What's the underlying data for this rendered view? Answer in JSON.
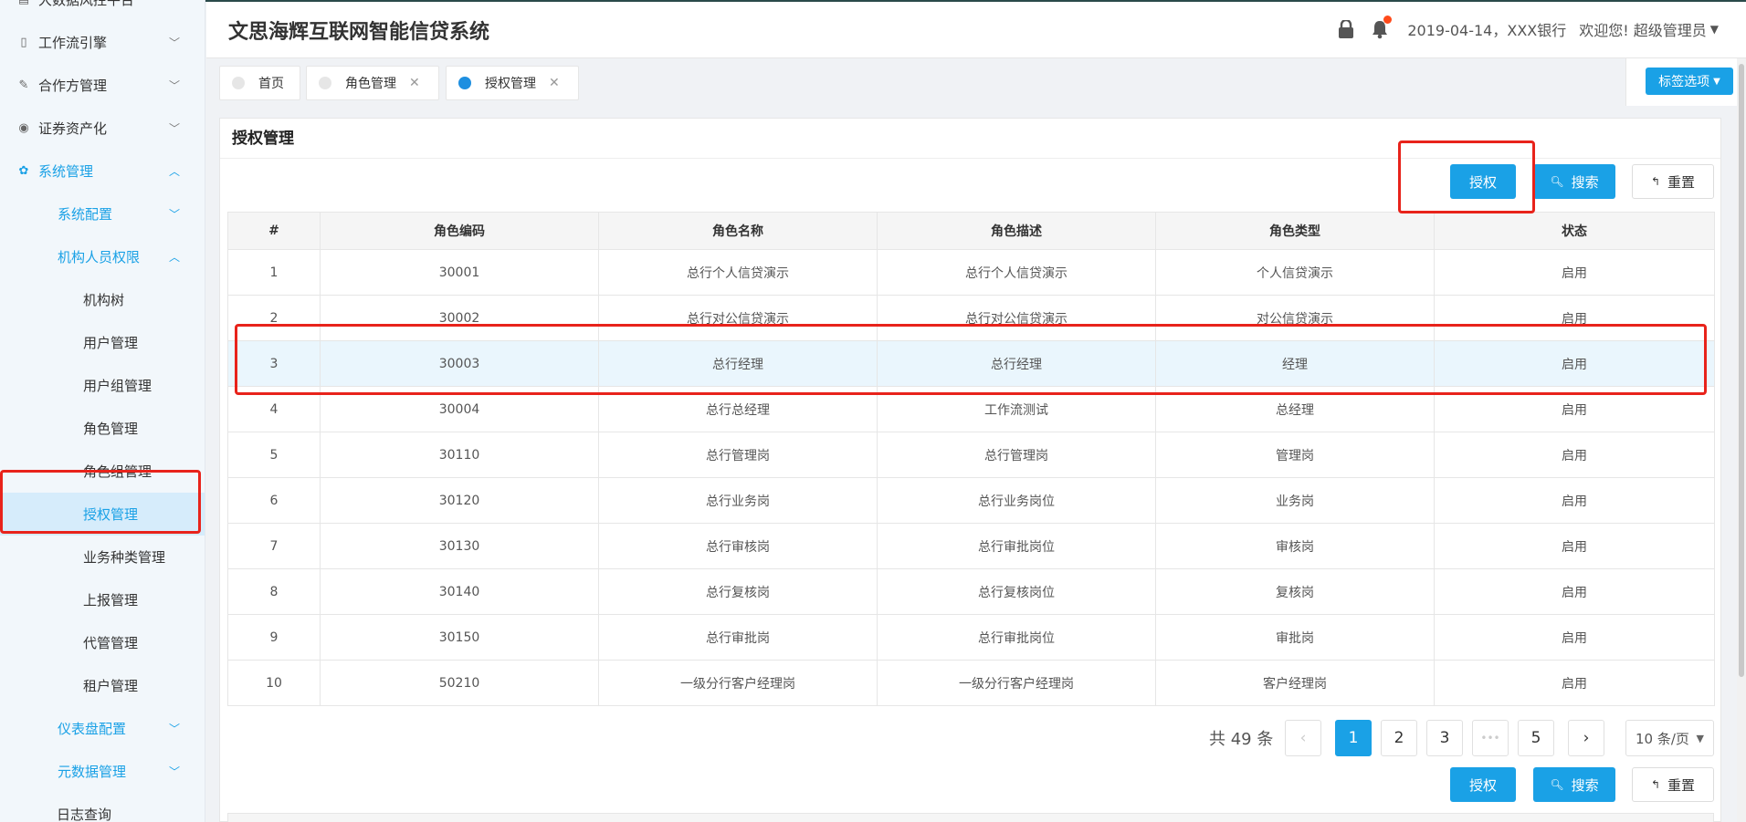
{
  "app": {
    "title": "文思海辉互联网智能信贷系统",
    "date_bank": "2019-04-14，XXX银行",
    "welcome": "欢迎您! 超级管理员",
    "accent": "#1aa1e6"
  },
  "sidebar": {
    "items": [
      {
        "label": "大数据风控平台",
        "icon": "chart-icon"
      },
      {
        "label": "工作流引擎",
        "icon": "mobile-icon"
      },
      {
        "label": "合作方管理",
        "icon": "brush-icon"
      },
      {
        "label": "证券资产化",
        "icon": "target-icon"
      },
      {
        "label": "系统管理",
        "icon": "gear-icon"
      },
      {
        "label": "系统配置"
      },
      {
        "label": "机构人员权限"
      },
      {
        "label": "机构树"
      },
      {
        "label": "用户管理"
      },
      {
        "label": "用户组管理"
      },
      {
        "label": "角色管理"
      },
      {
        "label": "角色组管理"
      },
      {
        "label": "授权管理"
      },
      {
        "label": "业务种类管理"
      },
      {
        "label": "上报管理"
      },
      {
        "label": "代管管理"
      },
      {
        "label": "租户管理"
      },
      {
        "label": "仪表盘配置"
      },
      {
        "label": "元数据管理"
      },
      {
        "label": "日志查询"
      }
    ]
  },
  "tabs": [
    {
      "label": "首页"
    },
    {
      "label": "角色管理"
    },
    {
      "label": "授权管理"
    }
  ],
  "tab_options": "标签选项",
  "panel": {
    "title": "授权管理",
    "auth_button": "授权",
    "search_button": "搜索",
    "reset_button": "重置"
  },
  "table": {
    "headers": [
      "#",
      "角色编码",
      "角色名称",
      "角色描述",
      "角色类型",
      "状态"
    ],
    "rows": [
      [
        "1",
        "30001",
        "总行个人信贷演示",
        "总行个人信贷演示",
        "个人信贷演示",
        "启用"
      ],
      [
        "2",
        "30002",
        "总行对公信贷演示",
        "总行对公信贷演示",
        "对公信贷演示",
        "启用"
      ],
      [
        "3",
        "30003",
        "总行经理",
        "总行经理",
        "经理",
        "启用"
      ],
      [
        "4",
        "30004",
        "总行总经理",
        "工作流测试",
        "总经理",
        "启用"
      ],
      [
        "5",
        "30110",
        "总行管理岗",
        "总行管理岗",
        "管理岗",
        "启用"
      ],
      [
        "6",
        "30120",
        "总行业务岗",
        "总行业务岗位",
        "业务岗",
        "启用"
      ],
      [
        "7",
        "30130",
        "总行审核岗",
        "总行审批岗位",
        "审核岗",
        "启用"
      ],
      [
        "8",
        "30140",
        "总行复核岗",
        "总行复核岗位",
        "复核岗",
        "启用"
      ],
      [
        "9",
        "30150",
        "总行审批岗",
        "总行审批岗位",
        "审批岗",
        "启用"
      ],
      [
        "10",
        "50210",
        "一级分行客户经理岗",
        "一级分行客户经理岗",
        "客户经理岗",
        "启用"
      ]
    ]
  },
  "pagination": {
    "total": "共 49 条",
    "pages": [
      "1",
      "2",
      "3",
      "•••",
      "5"
    ],
    "page_size": "10 条/页"
  }
}
